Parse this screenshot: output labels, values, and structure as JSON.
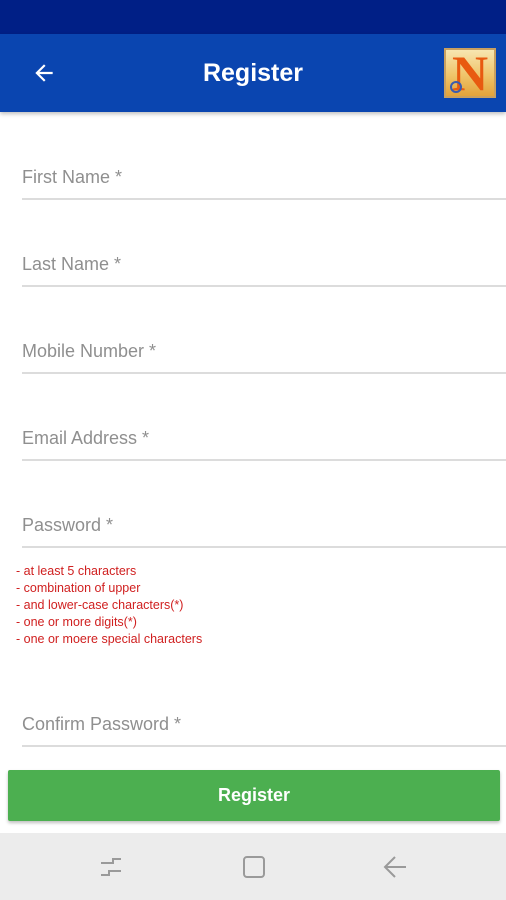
{
  "app_bar": {
    "title": "Register",
    "back_icon": "arrow-left-icon",
    "logo_letter": "N",
    "colors": {
      "status_bar": "#001f86",
      "app_bar": "#0a45b0"
    }
  },
  "form": {
    "first_name": {
      "placeholder": "First Name *",
      "value": ""
    },
    "last_name": {
      "placeholder": "Last Name *",
      "value": ""
    },
    "mobile": {
      "placeholder": "Mobile Number *",
      "value": ""
    },
    "email": {
      "placeholder": "Email Address *",
      "value": ""
    },
    "password": {
      "placeholder": "Password *",
      "value": ""
    },
    "password_hints": [
      "- at least 5 characters",
      "- combination of upper",
      "- and lower-case characters(*)",
      "- one or more digits(*)",
      "- one or moere special characters"
    ],
    "confirm_password": {
      "placeholder": "Confirm Password *",
      "value": ""
    },
    "submit_label": "Register",
    "colors": {
      "hint_text": "#d02020",
      "submit": "#4caf50"
    }
  },
  "nav_bar": {
    "recents_icon": "recents-icon",
    "home_icon": "home-icon",
    "back_icon": "back-icon"
  }
}
